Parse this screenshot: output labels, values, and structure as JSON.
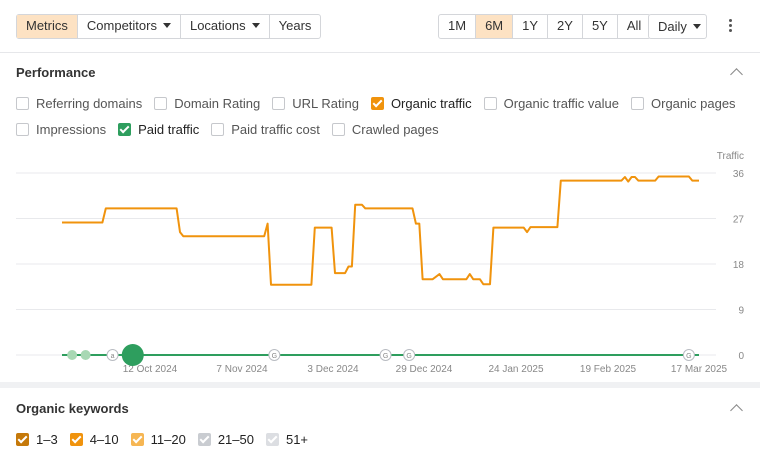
{
  "toolbar": {
    "tabs": [
      {
        "label": "Metrics",
        "active": true
      },
      {
        "label": "Competitors",
        "dropdown": true
      },
      {
        "label": "Locations",
        "dropdown": true
      },
      {
        "label": "Years"
      }
    ],
    "ranges": [
      "1M",
      "6M",
      "1Y",
      "2Y",
      "5Y",
      "All"
    ],
    "active_range": "6M",
    "interval": "Daily"
  },
  "performance": {
    "title": "Performance",
    "metrics": [
      {
        "label": "Referring domains",
        "checked": false
      },
      {
        "label": "Domain Rating",
        "checked": false
      },
      {
        "label": "URL Rating",
        "checked": false
      },
      {
        "label": "Organic traffic",
        "checked": true,
        "color": "#f0930d"
      },
      {
        "label": "Organic traffic value",
        "checked": false
      },
      {
        "label": "Organic pages",
        "checked": false
      },
      {
        "label": "Impressions",
        "checked": false
      },
      {
        "label": "Paid traffic",
        "checked": true,
        "color": "#2e9e5e"
      },
      {
        "label": "Paid traffic cost",
        "checked": false
      },
      {
        "label": "Crawled pages",
        "checked": false
      }
    ]
  },
  "chart_data": {
    "type": "line",
    "y_axis_title": "Traffic",
    "ylim": [
      0,
      36
    ],
    "y_ticks": [
      0,
      9,
      18,
      27,
      36
    ],
    "x_tick_labels": [
      "12 Oct 2024",
      "7 Nov 2024",
      "3 Dec 2024",
      "29 Dec 2024",
      "24 Jan 2025",
      "19 Feb 2025",
      "17 Mar 2025"
    ],
    "grid": true,
    "series": [
      {
        "color": "#f0930d",
        "points": [
          [
            "2024-09-18",
            26.2
          ],
          [
            "2024-09-30",
            26.2
          ],
          [
            "2024-10-01",
            29.0
          ],
          [
            "2024-10-22",
            29.0
          ],
          [
            "2024-10-23",
            24.3
          ],
          [
            "2024-10-24",
            23.5
          ],
          [
            "2024-11-17",
            23.5
          ],
          [
            "2024-11-18",
            26.0
          ],
          [
            "2024-11-19",
            13.9
          ],
          [
            "2024-12-01",
            13.9
          ],
          [
            "2024-12-02",
            25.2
          ],
          [
            "2024-12-07",
            25.2
          ],
          [
            "2024-12-08",
            16.2
          ],
          [
            "2024-12-11",
            16.2
          ],
          [
            "2024-12-12",
            17.5
          ],
          [
            "2024-12-13",
            17.5
          ],
          [
            "2024-12-14",
            29.7
          ],
          [
            "2024-12-16",
            29.7
          ],
          [
            "2024-12-17",
            29.0
          ],
          [
            "2024-12-31",
            29.0
          ],
          [
            "2025-01-01",
            26.0
          ],
          [
            "2025-01-02",
            26.0
          ],
          [
            "2025-01-03",
            15.0
          ],
          [
            "2025-01-06",
            15.0
          ],
          [
            "2025-01-08",
            16.0
          ],
          [
            "2025-01-09",
            15.0
          ],
          [
            "2025-01-16",
            15.0
          ],
          [
            "2025-01-17",
            16.0
          ],
          [
            "2025-01-18",
            15.0
          ],
          [
            "2025-01-20",
            15.0
          ],
          [
            "2025-01-21",
            14.0
          ],
          [
            "2025-01-23",
            14.0
          ],
          [
            "2025-01-24",
            25.2
          ],
          [
            "2025-02-02",
            25.2
          ],
          [
            "2025-02-03",
            24.3
          ],
          [
            "2025-02-04",
            25.3
          ],
          [
            "2025-02-12",
            25.3
          ],
          [
            "2025-02-13",
            34.5
          ],
          [
            "2025-03-03",
            34.5
          ],
          [
            "2025-03-04",
            35.2
          ],
          [
            "2025-03-05",
            34.3
          ],
          [
            "2025-03-06",
            35.2
          ],
          [
            "2025-03-07",
            35.2
          ],
          [
            "2025-03-08",
            34.5
          ],
          [
            "2025-03-13",
            34.5
          ],
          [
            "2025-03-14",
            35.3
          ],
          [
            "2025-03-23",
            35.3
          ],
          [
            "2025-03-24",
            34.5
          ],
          [
            "2025-03-26",
            34.5
          ]
        ]
      },
      {
        "color": "#2e9e5e",
        "points": [
          [
            "2024-09-18",
            0
          ],
          [
            "2025-03-26",
            0
          ]
        ]
      }
    ],
    "annotations": [
      {
        "date": "2024-09-21",
        "kind": "dot",
        "color": "#a8d8b4"
      },
      {
        "date": "2024-09-25",
        "kind": "dot",
        "color": "#a8d8b4"
      },
      {
        "date": "2024-10-03",
        "kind": "marker",
        "letter": "a"
      },
      {
        "date": "2024-10-09",
        "kind": "dot-large",
        "color": "#2e9e5e"
      },
      {
        "date": "2024-11-20",
        "kind": "marker",
        "letter": "G"
      },
      {
        "date": "2024-12-23",
        "kind": "marker",
        "letter": "G"
      },
      {
        "date": "2024-12-30",
        "kind": "marker",
        "letter": "G"
      },
      {
        "date": "2025-03-23",
        "kind": "marker",
        "letter": "G"
      }
    ]
  },
  "keywords": {
    "title": "Organic keywords",
    "filters": [
      {
        "label": "1–3",
        "checked": true,
        "color": "#c5790a"
      },
      {
        "label": "4–10",
        "checked": true,
        "color": "#f0930d"
      },
      {
        "label": "11–20",
        "checked": true,
        "color": "#f6b653"
      },
      {
        "label": "21–50",
        "checked": true,
        "color": "#c9ccd1"
      },
      {
        "label": "51+",
        "checked": true,
        "color": "#dcdee2"
      }
    ]
  }
}
